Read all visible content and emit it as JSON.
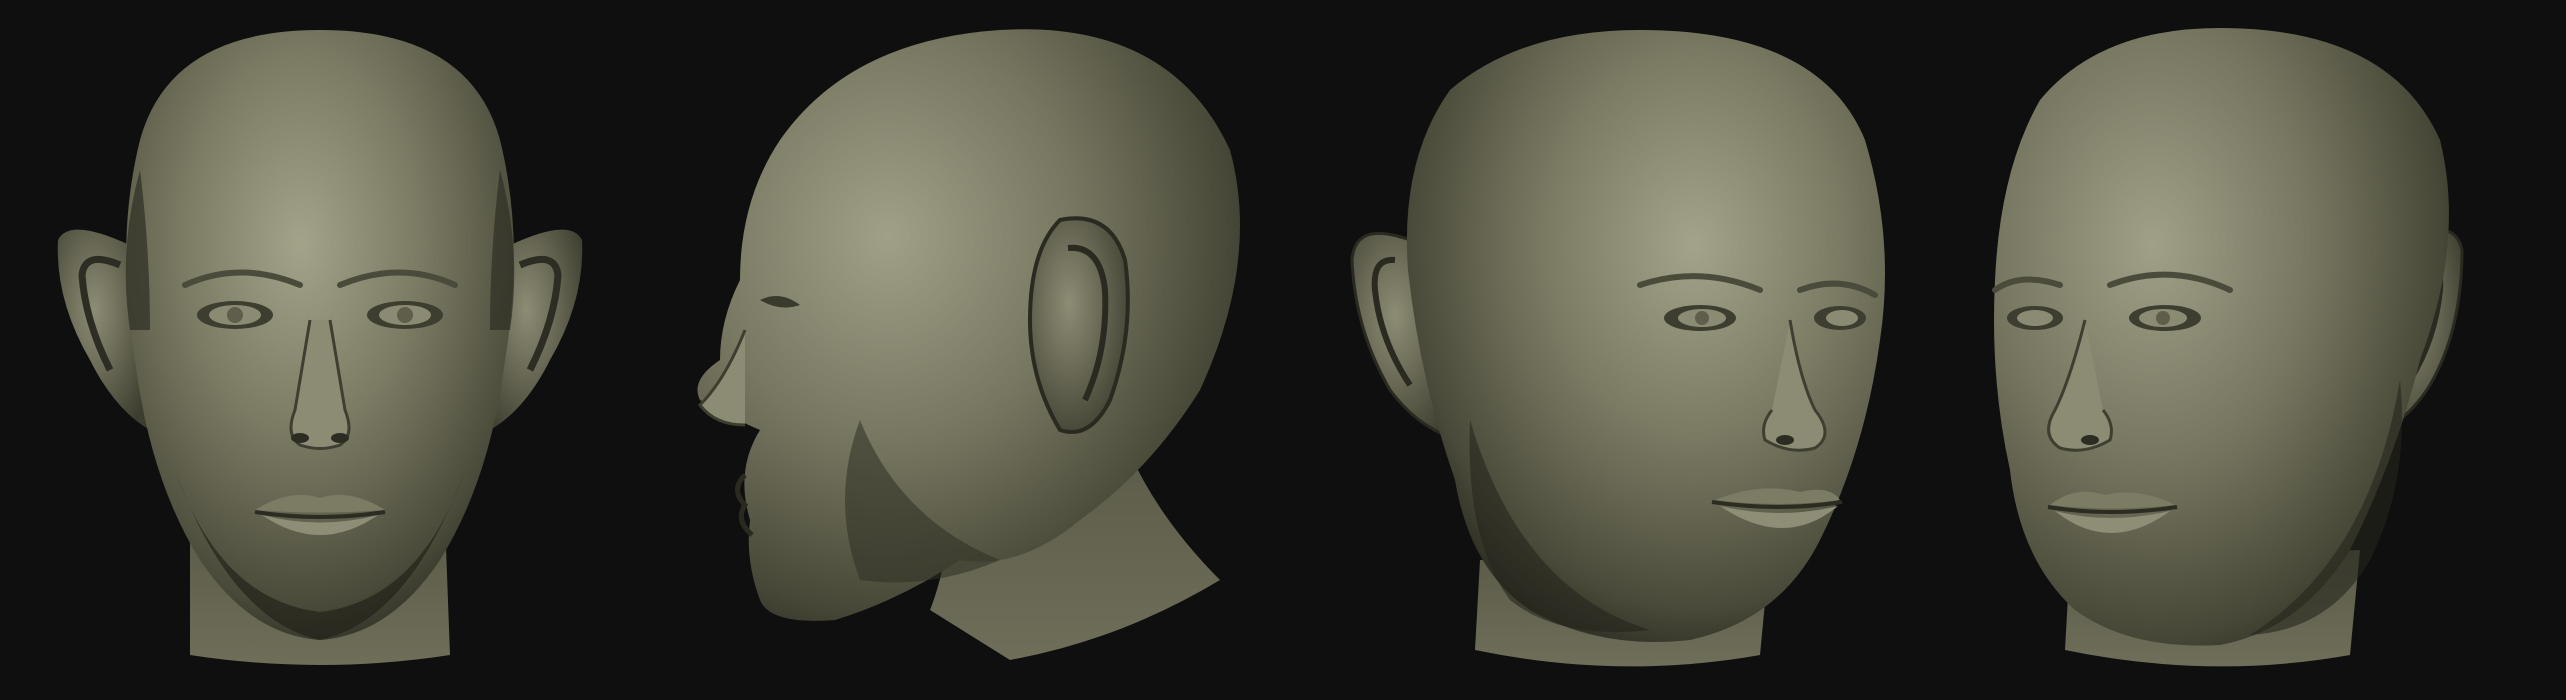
{
  "scene": {
    "subject": "3d-head-sculpt",
    "views": [
      {
        "id": "front",
        "icon": "head-front-view"
      },
      {
        "id": "left-profile",
        "icon": "head-left-profile-view"
      },
      {
        "id": "three-quarter-right",
        "icon": "head-three-quarter-right-view"
      },
      {
        "id": "three-quarter-left",
        "icon": "head-three-quarter-left-view"
      }
    ]
  },
  "colors": {
    "background": "#0f0f0f",
    "clay_light": "#9a9a82",
    "clay_mid": "#6f6f5a",
    "clay_dark": "#3e3e30",
    "clay_shadow": "#1c1c16"
  }
}
